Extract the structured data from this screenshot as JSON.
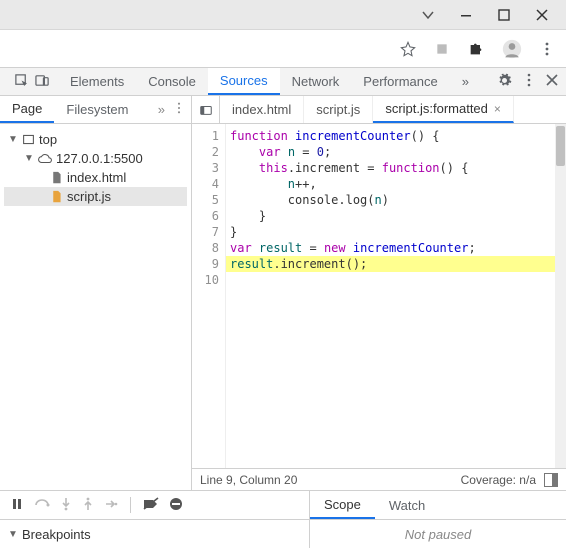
{
  "dev_tabs": {
    "items": [
      "Elements",
      "Console",
      "Sources",
      "Network",
      "Performance"
    ],
    "active": "Sources"
  },
  "left_panel": {
    "tabs": [
      "Page",
      "Filesystem"
    ],
    "active": "Page"
  },
  "tree": {
    "root": "top",
    "origin": "127.0.0.1:5500",
    "files": [
      "index.html",
      "script.js"
    ],
    "selected": "script.js"
  },
  "file_tabs": {
    "items": [
      {
        "name": "index.html",
        "active": false,
        "closable": false
      },
      {
        "name": "script.js",
        "active": false,
        "closable": false
      },
      {
        "name": "script.js:formatted",
        "active": true,
        "closable": true
      }
    ]
  },
  "code": {
    "lines": [
      {
        "n": 1,
        "indent": 0,
        "tokens": [
          [
            "k-purple",
            "function "
          ],
          [
            "k-blue",
            "incrementCounter"
          ],
          [
            "",
            "() {"
          ]
        ]
      },
      {
        "n": 2,
        "indent": 1,
        "tokens": [
          [
            "k-purple",
            "var "
          ],
          [
            "k-teal",
            "n"
          ],
          [
            "",
            " = "
          ],
          [
            "k-num",
            "0"
          ],
          [
            "",
            ";"
          ]
        ]
      },
      {
        "n": 3,
        "indent": 1,
        "tokens": [
          [
            "k-purple",
            "this"
          ],
          [
            "",
            ".increment = "
          ],
          [
            "k-purple",
            "function"
          ],
          [
            "",
            "() {"
          ]
        ]
      },
      {
        "n": 4,
        "indent": 2,
        "tokens": [
          [
            "k-teal",
            "n"
          ],
          [
            "",
            "++,"
          ]
        ]
      },
      {
        "n": 5,
        "indent": 2,
        "tokens": [
          [
            "",
            "console.log("
          ],
          [
            "k-teal",
            "n"
          ],
          [
            "",
            ")"
          ]
        ]
      },
      {
        "n": 6,
        "indent": 1,
        "tokens": [
          [
            "",
            "}"
          ]
        ]
      },
      {
        "n": 7,
        "indent": 0,
        "tokens": [
          [
            "",
            "}"
          ]
        ]
      },
      {
        "n": 8,
        "indent": 0,
        "tokens": [
          [
            "k-purple",
            "var "
          ],
          [
            "k-teal",
            "result"
          ],
          [
            "",
            " = "
          ],
          [
            "k-purple",
            "new "
          ],
          [
            "k-blue",
            "incrementCounter"
          ],
          [
            "",
            ";"
          ]
        ]
      },
      {
        "n": 9,
        "indent": 0,
        "hl": true,
        "tokens": [
          [
            "k-teal",
            "result"
          ],
          [
            "",
            ".increment();"
          ]
        ]
      },
      {
        "n": 10,
        "indent": 0,
        "tokens": []
      }
    ]
  },
  "status": {
    "left": "Line 9, Column 20",
    "coverage": "Coverage: n/a"
  },
  "debugger": {
    "tabs": [
      "Scope",
      "Watch"
    ],
    "active": "Scope",
    "breakpoints_label": "Breakpoints",
    "state_text": "Not paused"
  }
}
